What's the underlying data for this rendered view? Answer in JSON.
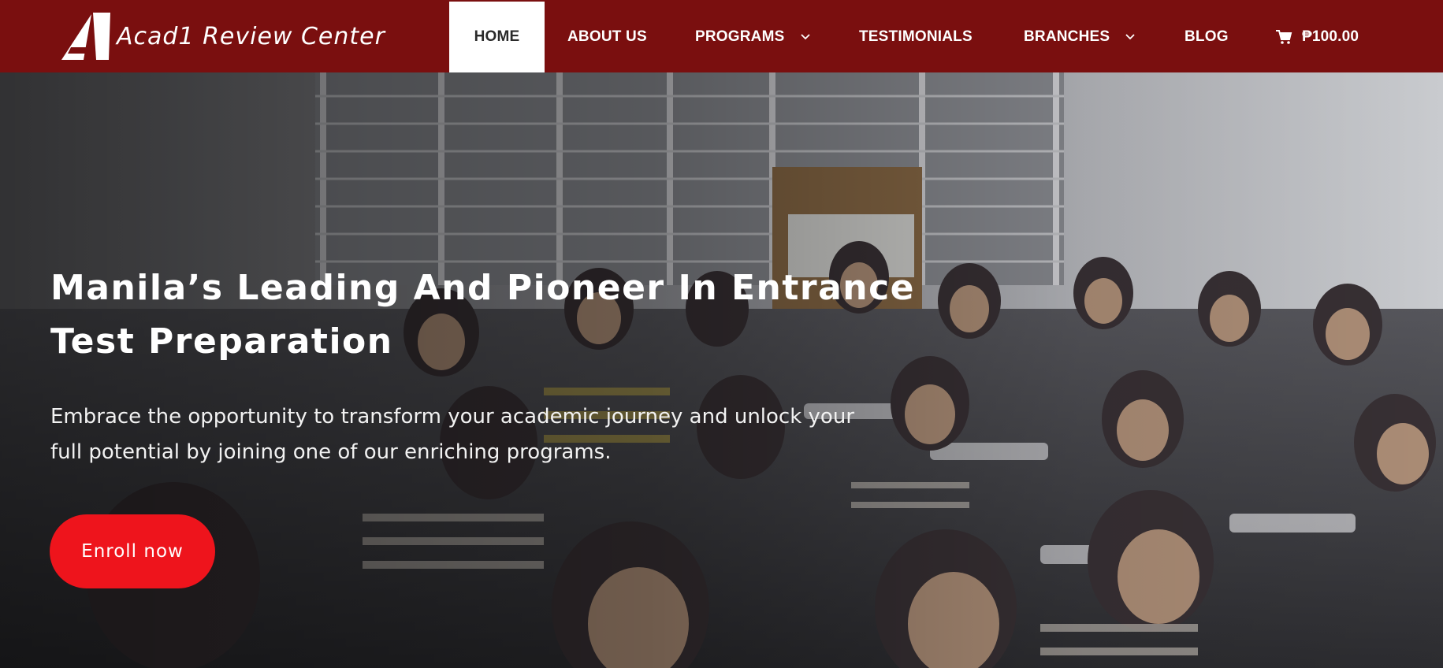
{
  "brand": {
    "name": "Acad1 Review Center",
    "logo_icon": "a1-logo-icon"
  },
  "nav": {
    "items": [
      {
        "label": "HOME",
        "active": true
      },
      {
        "label": "ABOUT US"
      },
      {
        "label": "PROGRAMS",
        "has_dropdown": true
      },
      {
        "label": "TESTIMONIALS"
      },
      {
        "label": "BRANCHES",
        "has_dropdown": true
      },
      {
        "label": "BLOG"
      }
    ],
    "cart": {
      "icon": "cart-icon",
      "total": "₱100.00"
    }
  },
  "hero": {
    "title": "Manila’s Leading And Pioneer In Entrance Test Preparation",
    "subtitle": "Embrace the opportunity to transform your academic journey and unlock your full potential by joining one of our enriching programs.",
    "cta_label": "Enroll now",
    "background_image": "classroom-students-photo"
  },
  "colors": {
    "navbar": "#7a0f0f",
    "cta": "#ee141c",
    "active_tab_bg": "#ffffff"
  }
}
